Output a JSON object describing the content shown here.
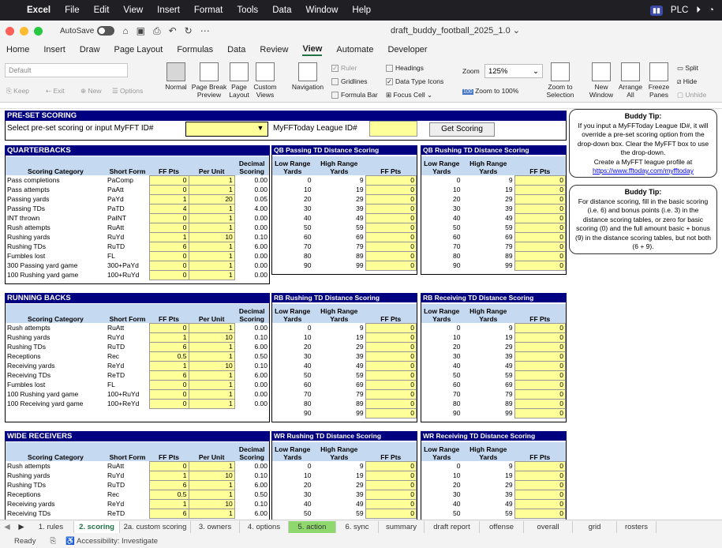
{
  "mac": {
    "app": "Excel",
    "menu": [
      "File",
      "Edit",
      "View",
      "Insert",
      "Format",
      "Tools",
      "Data",
      "Window",
      "Help"
    ],
    "plc": "PLC"
  },
  "window": {
    "autosave": "AutoSave",
    "title": "draft_buddy_football_2025_1.0 ⌄"
  },
  "tabs": [
    "Home",
    "Insert",
    "Draw",
    "Page Layout",
    "Formulas",
    "Data",
    "Review",
    "View",
    "Automate",
    "Developer"
  ],
  "active_tab": "View",
  "ribbon": {
    "style": "Default",
    "keep": "Keep",
    "exit": "Exit",
    "new": "New",
    "options": "Options",
    "normal": "Normal",
    "page_break": "Page Break Preview",
    "page_layout": "Page Layout",
    "custom_views": "Custom Views",
    "navigation": "Navigation",
    "ruler": "Ruler",
    "gridlines": "Gridlines",
    "formula_bar": "Formula Bar",
    "headings": "Headings",
    "data_type_icons": "Data Type Icons",
    "focus_cell": "Focus Cell",
    "zoom_label": "Zoom",
    "zoom_value": "125%",
    "zoom_100": "Zoom to 100%",
    "zoom_sel": "Zoom to Selection",
    "new_window": "New Window",
    "arrange_all": "Arrange All",
    "freeze": "Freeze Panes",
    "split": "Split",
    "hide": "Hide",
    "unhide": "Unhide"
  },
  "sheet": {
    "title": "PRE-SET SCORING",
    "select_label": "Select pre-set scoring or input MyFFT ID#",
    "league_label": "MyFFToday League ID#",
    "get_scoring": "Get Scoring",
    "tip1": {
      "title": "Buddy Tip:",
      "body": "If you input a MyFFToday League ID#, it will override a pre-set scoring option from the drop-down box. Clear the MyFFT box to use the drop-down.",
      "line2": "Create a MyFFT league profile at",
      "link": "https://www.fftoday.com/myfftoday"
    },
    "tip2": {
      "title": "Buddy Tip:",
      "body": "For distance scoring, fill in the basic scoring (i.e. 6) and bonus points (i.e. 3) in the distance scoring tables, or zero for basic scoring (0) and the full amount basic + bonus (9) in the distance scoring tables, but not both (6 + 9)."
    },
    "cols": {
      "cat": "Scoring Category",
      "short": "Short Form",
      "ff": "FF Pts",
      "per": "Per Unit",
      "dec1": "Decimal",
      "dec2": "Scoring",
      "low1": "Low Range",
      "low2": "Yards",
      "high1": "High Range",
      "high2": "Yards"
    },
    "sections": [
      {
        "title": "QUARTERBACKS",
        "rows": [
          [
            "Pass completions",
            "PaComp",
            "0",
            "1",
            "0.00"
          ],
          [
            "Pass attempts",
            "PaAtt",
            "0",
            "1",
            "0.00"
          ],
          [
            "Passing yards",
            "PaYd",
            "1",
            "20",
            "0.05"
          ],
          [
            "Passing TDs",
            "PaTD",
            "4",
            "1",
            "4.00"
          ],
          [
            "INT thrown",
            "PaINT",
            "0",
            "1",
            "0.00"
          ],
          [
            "Rush attempts",
            "RuAtt",
            "0",
            "1",
            "0.00"
          ],
          [
            "Rushing yards",
            "RuYd",
            "1",
            "10",
            "0.10"
          ],
          [
            "Rushing TDs",
            "RuTD",
            "6",
            "1",
            "6.00"
          ],
          [
            "Fumbles lost",
            "FL",
            "0",
            "1",
            "0.00"
          ],
          [
            "300 Passing yard game",
            "300+PaYd",
            "0",
            "1",
            "0.00"
          ],
          [
            "100 Rushing yard game",
            "100+RuYd",
            "0",
            "1",
            "0.00"
          ]
        ],
        "dist": [
          {
            "title": "QB Passing TD Distance Scoring",
            "rows": [
              [
                "0",
                "9",
                "0"
              ],
              [
                "10",
                "19",
                "0"
              ],
              [
                "20",
                "29",
                "0"
              ],
              [
                "30",
                "39",
                "0"
              ],
              [
                "40",
                "49",
                "0"
              ],
              [
                "50",
                "59",
                "0"
              ],
              [
                "60",
                "69",
                "0"
              ],
              [
                "70",
                "79",
                "0"
              ],
              [
                "80",
                "89",
                "0"
              ],
              [
                "90",
                "99",
                "0"
              ]
            ]
          },
          {
            "title": "QB Rushing TD Distance Scoring",
            "rows": [
              [
                "0",
                "9",
                "0"
              ],
              [
                "10",
                "19",
                "0"
              ],
              [
                "20",
                "29",
                "0"
              ],
              [
                "30",
                "39",
                "0"
              ],
              [
                "40",
                "49",
                "0"
              ],
              [
                "50",
                "59",
                "0"
              ],
              [
                "60",
                "69",
                "0"
              ],
              [
                "70",
                "79",
                "0"
              ],
              [
                "80",
                "89",
                "0"
              ],
              [
                "90",
                "99",
                "0"
              ]
            ]
          }
        ]
      },
      {
        "title": "RUNNING BACKS",
        "rows": [
          [
            "Rush attempts",
            "RuAtt",
            "0",
            "1",
            "0.00"
          ],
          [
            "Rushing yards",
            "RuYd",
            "1",
            "10",
            "0.10"
          ],
          [
            "Rushing TDs",
            "RuTD",
            "6",
            "1",
            "6.00"
          ],
          [
            "Receptions",
            "Rec",
            "0.5",
            "1",
            "0.50"
          ],
          [
            "Receiving yards",
            "ReYd",
            "1",
            "10",
            "0.10"
          ],
          [
            "Receiving TDs",
            "ReTD",
            "6",
            "1",
            "6.00"
          ],
          [
            "Fumbles lost",
            "FL",
            "0",
            "1",
            "0.00"
          ],
          [
            "100 Rushing yard game",
            "100+RuYd",
            "0",
            "1",
            "0.00"
          ],
          [
            "100 Receiving yard game",
            "100+ReYd",
            "0",
            "1",
            "0.00"
          ]
        ],
        "dist": [
          {
            "title": "RB Rushing TD Distance Scoring",
            "rows": [
              [
                "0",
                "9",
                "0"
              ],
              [
                "10",
                "19",
                "0"
              ],
              [
                "20",
                "29",
                "0"
              ],
              [
                "30",
                "39",
                "0"
              ],
              [
                "40",
                "49",
                "0"
              ],
              [
                "50",
                "59",
                "0"
              ],
              [
                "60",
                "69",
                "0"
              ],
              [
                "70",
                "79",
                "0"
              ],
              [
                "80",
                "89",
                "0"
              ],
              [
                "90",
                "99",
                "0"
              ]
            ]
          },
          {
            "title": "RB Receiving TD Distance Scoring",
            "rows": [
              [
                "0",
                "9",
                "0"
              ],
              [
                "10",
                "19",
                "0"
              ],
              [
                "20",
                "29",
                "0"
              ],
              [
                "30",
                "39",
                "0"
              ],
              [
                "40",
                "49",
                "0"
              ],
              [
                "50",
                "59",
                "0"
              ],
              [
                "60",
                "69",
                "0"
              ],
              [
                "70",
                "79",
                "0"
              ],
              [
                "80",
                "89",
                "0"
              ],
              [
                "90",
                "99",
                "0"
              ]
            ]
          }
        ]
      },
      {
        "title": "WIDE RECEIVERS",
        "rows": [
          [
            "Rush attempts",
            "RuAtt",
            "0",
            "1",
            "0.00"
          ],
          [
            "Rushing yards",
            "RuYd",
            "1",
            "10",
            "0.10"
          ],
          [
            "Rushing TDs",
            "RuTD",
            "6",
            "1",
            "6.00"
          ],
          [
            "Receptions",
            "Rec",
            "0.5",
            "1",
            "0.50"
          ],
          [
            "Receiving yards",
            "ReYd",
            "1",
            "10",
            "0.10"
          ],
          [
            "Receiving TDs",
            "ReTD",
            "6",
            "1",
            "6.00"
          ]
        ],
        "dist": [
          {
            "title": "WR Rushing TD Distance Scoring",
            "rows": [
              [
                "0",
                "9",
                "0"
              ],
              [
                "10",
                "19",
                "0"
              ],
              [
                "20",
                "29",
                "0"
              ],
              [
                "30",
                "39",
                "0"
              ],
              [
                "40",
                "49",
                "0"
              ],
              [
                "50",
                "59",
                "0"
              ]
            ]
          },
          {
            "title": "WR Receiving TD Distance Scoring",
            "rows": [
              [
                "0",
                "9",
                "0"
              ],
              [
                "10",
                "19",
                "0"
              ],
              [
                "20",
                "29",
                "0"
              ],
              [
                "30",
                "39",
                "0"
              ],
              [
                "40",
                "49",
                "0"
              ],
              [
                "50",
                "59",
                "0"
              ]
            ]
          }
        ]
      }
    ]
  },
  "sheet_tabs": [
    "1. rules",
    "2. scoring",
    "2a. custom scoring",
    "3. owners",
    "4. options",
    "5. action",
    "6. sync",
    "summary",
    "draft report",
    "offense",
    "overall",
    "grid",
    "rosters"
  ],
  "status": {
    "ready": "Ready",
    "accessibility": "Accessibility: Investigate"
  }
}
